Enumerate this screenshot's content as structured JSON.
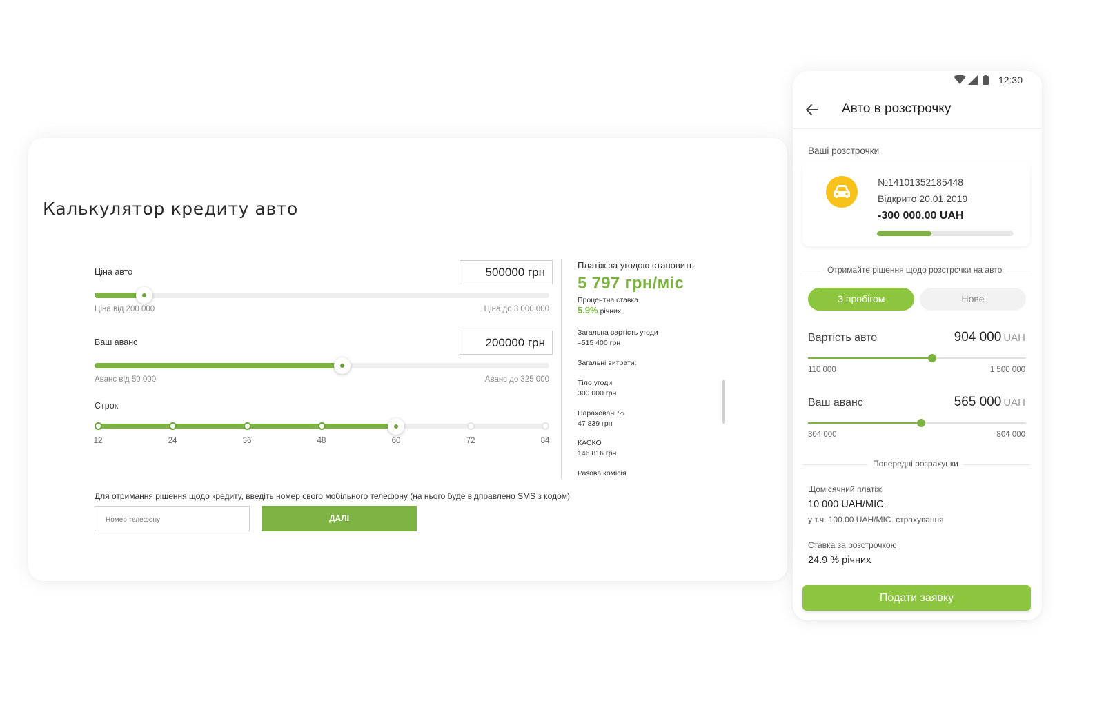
{
  "calculator": {
    "title": "Калькулятор кредиту авто",
    "price": {
      "label": "Ціна авто",
      "value": "500000 грн",
      "min_label": "Ціна від 200 000",
      "max_label": "Ціна до 3 000 000",
      "slider_fraction": 0.11
    },
    "advance": {
      "label": "Ваш аванс",
      "value": "200000 грн",
      "min_label": "Аванс від 50 000",
      "max_label": "Аванс до 325 000",
      "slider_fraction": 0.545
    },
    "term": {
      "label": "Строк",
      "ticks": [
        "12",
        "24",
        "36",
        "48",
        "60",
        "72",
        "84"
      ],
      "selected": "60"
    },
    "result": {
      "heading": "Платіж за угодою становить",
      "monthly": "5 797 грн/міс",
      "rate_label": "Процентна ставка",
      "rate_value": "5.9%",
      "rate_suffix": "річних",
      "total_label": "Загальна вартість угоди",
      "total_value": "≈515 400 грн",
      "expenses_label": "Загальні витрати:",
      "body_label": "Тіло угоди",
      "body_value": "300 000 грн",
      "interest_label": "Нараховані %",
      "interest_value": "47 839 грн",
      "kasko_label": "КАСКО",
      "kasko_value": "146 816 грн",
      "fee_label": "Разова комісія"
    },
    "sms_note": "Для отримання рішення щодо кредиту, введіть номер свого мобільного телефону (на нього буде відправлено SMS з кодом)",
    "phone_placeholder": "Номер телефону",
    "next_button": "ДАЛІ"
  },
  "mobile": {
    "status_time": "12:30",
    "title": "Авто в розстрочку",
    "section_title": "Ваші розстрочки",
    "loan": {
      "number": "№14101352185448",
      "opened": "Відкрито 20.01.2019",
      "amount": "-300 000.00 UAH",
      "progress_fraction": 0.4
    },
    "decision_note": "Отримайте рішення щодо розстрочки на авто",
    "segments": {
      "used": "З пробігом",
      "new": "Нове"
    },
    "car_cost": {
      "label": "Вартість авто",
      "value": "904 000",
      "currency": "UAH",
      "min": "110 000",
      "max": "1 500 000",
      "slider_fraction": 0.57
    },
    "advance": {
      "label": "Ваш аванс",
      "value": "565 000",
      "currency": "UAH",
      "min": "304 000",
      "max": "804 000",
      "slider_fraction": 0.52
    },
    "prelim_note": "Попередні розрахунки",
    "monthly_label": "Щомісячний платіж",
    "monthly_value": "10 000 UAH/МІС.",
    "monthly_sub": "у т.ч. 100.00 UAH/МІС. страхування",
    "rate_label": "Ставка за розстрочкою",
    "rate_value": "24.9 % річних",
    "submit_button": "Подати заявку"
  },
  "colors": {
    "accent_green": "#7cb342",
    "button_green": "#8cc63f",
    "badge_yellow": "#f6c21b"
  },
  "icons": [
    "back-arrow-icon",
    "wifi-icon",
    "signal-icon",
    "battery-icon",
    "car-icon"
  ]
}
